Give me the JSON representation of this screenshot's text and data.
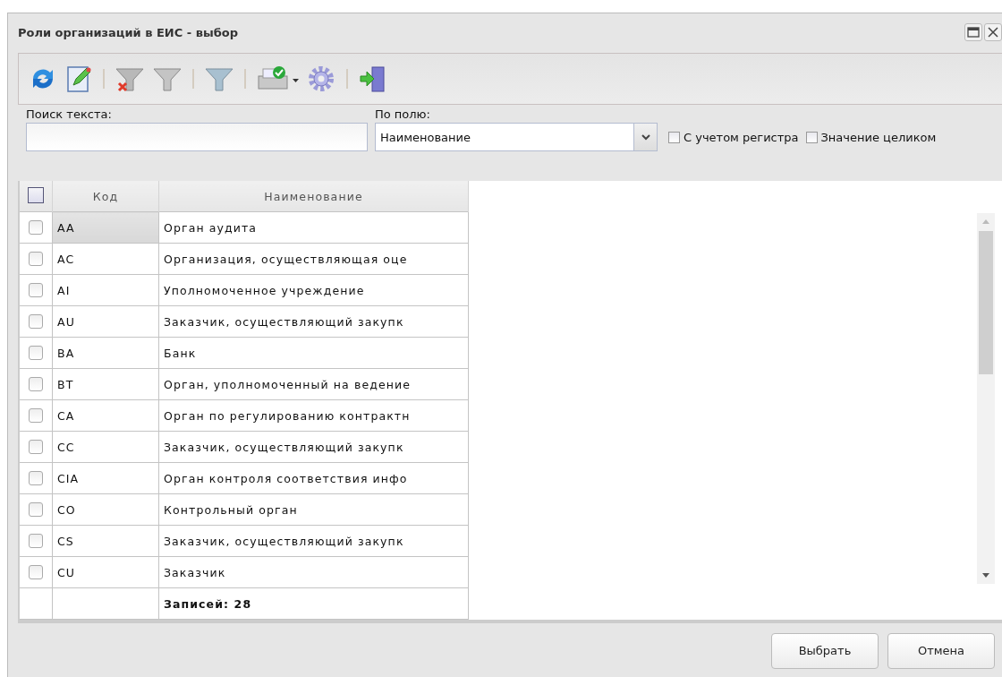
{
  "window": {
    "title": "Роли организаций в ЕИС - выбор"
  },
  "toolbar": [
    {
      "kind": "refresh"
    },
    {
      "kind": "edit"
    },
    {
      "kind": "separator"
    },
    {
      "kind": "filter-clear"
    },
    {
      "kind": "filter"
    },
    {
      "kind": "separator"
    },
    {
      "kind": "filter-blue"
    },
    {
      "kind": "separator"
    },
    {
      "kind": "print"
    },
    {
      "kind": "gear"
    },
    {
      "kind": "separator"
    },
    {
      "kind": "exit"
    }
  ],
  "search": {
    "label": "Поиск текста:"
  },
  "field": {
    "label": "По полю:",
    "value": "Наименование"
  },
  "options": [
    {
      "label": "С учетом регистра",
      "checked": false
    },
    {
      "label": "Значение целиком",
      "checked": false
    }
  ],
  "table": {
    "select_all": false,
    "columns": [
      "Код",
      "Наименование"
    ],
    "rows": [
      {
        "code": "AA",
        "name": "Орган аудита",
        "checked": false,
        "selected": true
      },
      {
        "code": "AC",
        "name": "Организация, осуществляющая оце",
        "checked": false,
        "selected": false
      },
      {
        "code": "AI",
        "name": "Уполномоченное учреждение",
        "checked": false,
        "selected": false
      },
      {
        "code": "AU",
        "name": "Заказчик, осуществляющий закупк",
        "checked": false,
        "selected": false
      },
      {
        "code": "BA",
        "name": "Банк",
        "checked": false,
        "selected": false
      },
      {
        "code": "BT",
        "name": "Орган, уполномоченный на ведение",
        "checked": false,
        "selected": false
      },
      {
        "code": "CA",
        "name": "Орган по регулированию контрактн",
        "checked": false,
        "selected": false
      },
      {
        "code": "CC",
        "name": "Заказчик, осуществляющий закупк",
        "checked": false,
        "selected": false
      },
      {
        "code": "CIA",
        "name": "Орган контроля соответствия инфо",
        "checked": false,
        "selected": false
      },
      {
        "code": "CO",
        "name": "Контрольный орган",
        "checked": false,
        "selected": false
      },
      {
        "code": "CS",
        "name": "Заказчик, осуществляющий закупк",
        "checked": false,
        "selected": false
      },
      {
        "code": "CU",
        "name": "Заказчик",
        "checked": false,
        "selected": false
      }
    ],
    "summary": "Записей: 28"
  },
  "buttons": [
    "Выбрать",
    "Отмена"
  ]
}
